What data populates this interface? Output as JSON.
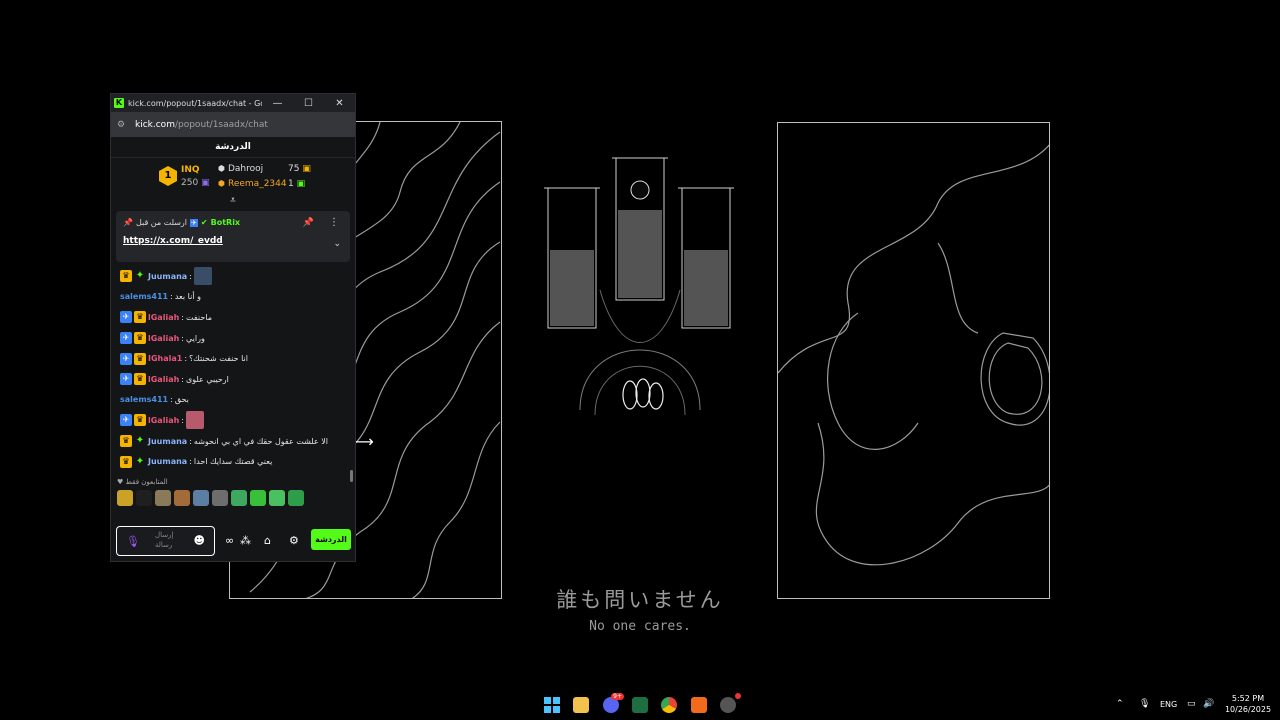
{
  "window": {
    "title": "kick.com/popout/1saadx/chat - Goo...",
    "url_host": "kick.com",
    "url_path": "/popout/1saadx/chat",
    "controls": [
      "—",
      "☐",
      "✕"
    ]
  },
  "chat": {
    "header": "الدردشة",
    "leaderboard": {
      "rank": "1",
      "top_name": "INQ",
      "top_count": "250",
      "rows": [
        {
          "name": "Dahrooj",
          "value": "75"
        },
        {
          "name": "Reema_2344",
          "value": "1"
        }
      ]
    },
    "pinned": {
      "label": "ارسلت من قبل",
      "author": "BotRix",
      "link": "https://x.com/_evdd"
    },
    "messages": [
      {
        "badges": [
          "crown",
          "spark"
        ],
        "user": "Juumana",
        "sep": ":",
        "text": "",
        "emote": "blue",
        "ucls": "u-j"
      },
      {
        "badges": [],
        "user": "salems411",
        "sep": ":",
        "text": "و أنا بعد",
        "emote": "",
        "ucls": "u-s"
      },
      {
        "badges": [
          "ff",
          "crown"
        ],
        "user": "lGaliah",
        "sep": ":",
        "text": "ماحنفت",
        "emote": "",
        "ucls": "u-g"
      },
      {
        "badges": [
          "ff",
          "crown"
        ],
        "user": "lGaliah",
        "sep": ":",
        "text": "ورايي",
        "emote": "",
        "ucls": "u-g"
      },
      {
        "badges": [
          "ff",
          "crown"
        ],
        "user": "IGhala1",
        "sep": ":",
        "text": "انا حنفت شحنتك؟",
        "emote": "",
        "ucls": "u-g"
      },
      {
        "badges": [
          "ff",
          "crown"
        ],
        "user": "lGaliah",
        "sep": ":",
        "text": "ارحيبي علوى",
        "emote": "",
        "ucls": "u-g"
      },
      {
        "badges": [],
        "user": "salems411",
        "sep": ":",
        "text": "بحق",
        "emote": "",
        "ucls": "u-s"
      },
      {
        "badges": [
          "ff",
          "crown"
        ],
        "user": "lGaliah",
        "sep": ":",
        "text": "",
        "emote": "pink",
        "ucls": "u-g"
      },
      {
        "badges": [
          "crown",
          "spark"
        ],
        "user": "Juumana",
        "sep": ":",
        "text": "الا علشت عقول حقك في اي بي انحوشه",
        "emote": "",
        "ucls": "u-j"
      },
      {
        "badges": [
          "crown",
          "spark"
        ],
        "user": "Juumana",
        "sep": ":",
        "text": "يعني قصتك سدايك احدا",
        "emote": "",
        "ucls": "u-j"
      }
    ],
    "emote_section": "المتابعون فقط",
    "emote_colors": [
      "#c9a227",
      "#1f1f1f",
      "#8a7a5a",
      "#a36a3a",
      "#5c7ea3",
      "#6d6d6d",
      "#3fa860",
      "#38c03a",
      "#4ac060",
      "#2f9e4a"
    ],
    "input_placeholder": "إرسال رسالة",
    "send_label": "الدردشة"
  },
  "wallpaper": {
    "jp": "誰も問いません",
    "en": "No one cares."
  },
  "taskbar": {
    "apps": [
      "windows-start",
      "file-explorer",
      "discord",
      "excel",
      "chrome",
      "app-orange",
      "app-circle"
    ],
    "discord_badge": "9+",
    "lang": "ENG",
    "time": "5:52 PM",
    "date": "10/26/2025"
  }
}
